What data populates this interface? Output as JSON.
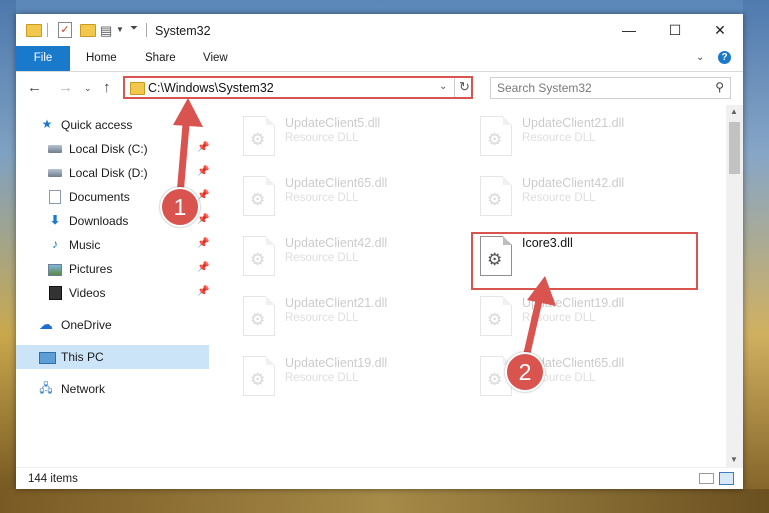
{
  "window": {
    "title": "System32",
    "controls": {
      "minimize": "—",
      "maximize": "☐",
      "close": "✕"
    }
  },
  "ribbon": {
    "tabs": [
      "File",
      "Home",
      "Share",
      "View"
    ]
  },
  "navigation": {
    "address_path": "C:\\Windows\\System32",
    "search_placeholder": "Search System32"
  },
  "sidebar": {
    "items": [
      {
        "label": "Quick access",
        "icon": "star-icon"
      },
      {
        "label": "Local Disk (C:)",
        "icon": "drive-icon",
        "pinned": true
      },
      {
        "label": "Local Disk (D:)",
        "icon": "drive-icon",
        "pinned": true
      },
      {
        "label": "Documents",
        "icon": "documents-icon",
        "pinned": true
      },
      {
        "label": "Downloads",
        "icon": "downloads-icon",
        "pinned": true
      },
      {
        "label": "Music",
        "icon": "music-icon",
        "pinned": true
      },
      {
        "label": "Pictures",
        "icon": "pictures-icon",
        "pinned": true
      },
      {
        "label": "Videos",
        "icon": "videos-icon",
        "pinned": true
      },
      {
        "label": "OneDrive",
        "icon": "cloud-icon"
      },
      {
        "label": "This PC",
        "icon": "computer-icon",
        "selected": true
      },
      {
        "label": "Network",
        "icon": "network-icon"
      }
    ]
  },
  "files": [
    {
      "name": "UpdateClient5.dll",
      "type": "Resource DLL"
    },
    {
      "name": "UpdateClient21.dll",
      "type": "Resource DLL"
    },
    {
      "name": "UpdateClient65.dll",
      "type": "Resource DLL"
    },
    {
      "name": "UpdateClient42.dll",
      "type": "Resource DLL"
    },
    {
      "name": "UpdateClient42.dll",
      "type": "Resource DLL"
    },
    {
      "name": "Icore3.dll",
      "type": "",
      "highlighted": true
    },
    {
      "name": "UpdateClient21.dll",
      "type": "Resource DLL"
    },
    {
      "name": "UpdateClient19.dll",
      "type": "Resource DLL"
    },
    {
      "name": "UpdateClient19.dll",
      "type": "Resource DLL"
    },
    {
      "name": "UpdateClient65.dll",
      "type": "Resource DLL"
    }
  ],
  "status": {
    "item_count": "144 items"
  },
  "annotations": {
    "step1": "1",
    "step2": "2"
  },
  "colors": {
    "accent": "#1979ca",
    "annotation": "#d9534f",
    "selected": "#cce4f7"
  }
}
